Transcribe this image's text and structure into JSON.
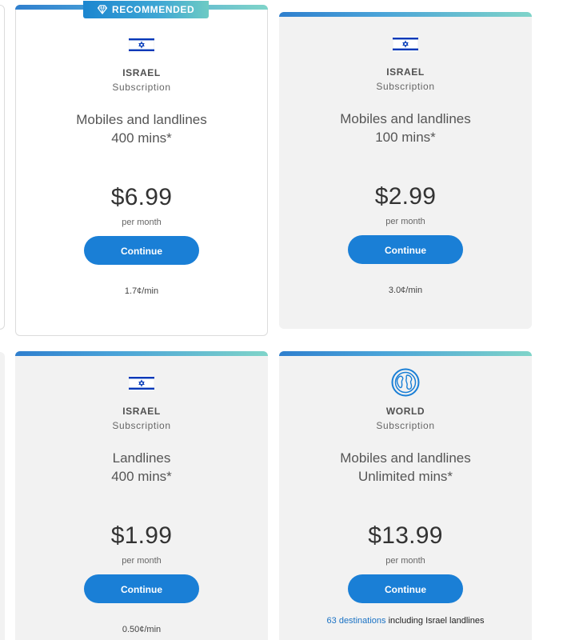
{
  "badge": {
    "label": "RECOMMENDED"
  },
  "plans": [
    {
      "country": "ISRAEL",
      "type": "Subscription",
      "desc_line1": "Mobiles and landlines",
      "desc_line2": "400 mins*",
      "price": "$6.99",
      "period": "per month",
      "cta": "Continue",
      "rate": "1.7¢/min",
      "icon": "israel-flag-icon"
    },
    {
      "country": "ISRAEL",
      "type": "Subscription",
      "desc_line1": "Mobiles and landlines",
      "desc_line2": "100 mins*",
      "price": "$2.99",
      "period": "per month",
      "cta": "Continue",
      "rate": "3.0¢/min",
      "icon": "israel-flag-icon"
    },
    {
      "country": "ISRAEL",
      "type": "Subscription",
      "desc_line1": "Landlines",
      "desc_line2": "400 mins*",
      "price": "$1.99",
      "period": "per month",
      "cta": "Continue",
      "rate": "0.50¢/min",
      "icon": "israel-flag-icon"
    },
    {
      "country": "WORLD",
      "type": "Subscription",
      "desc_line1": "Mobiles and landlines",
      "desc_line2": "Unlimited mins*",
      "price": "$13.99",
      "period": "per month",
      "cta": "Continue",
      "dest_link": "63 destinations",
      "dest_rest": " including Israel landlines",
      "icon": "globe-icon"
    }
  ],
  "colors": {
    "accent": "#1a7fd6",
    "card_gray": "#f2f2f2",
    "flag_blue": "#0038b8"
  }
}
